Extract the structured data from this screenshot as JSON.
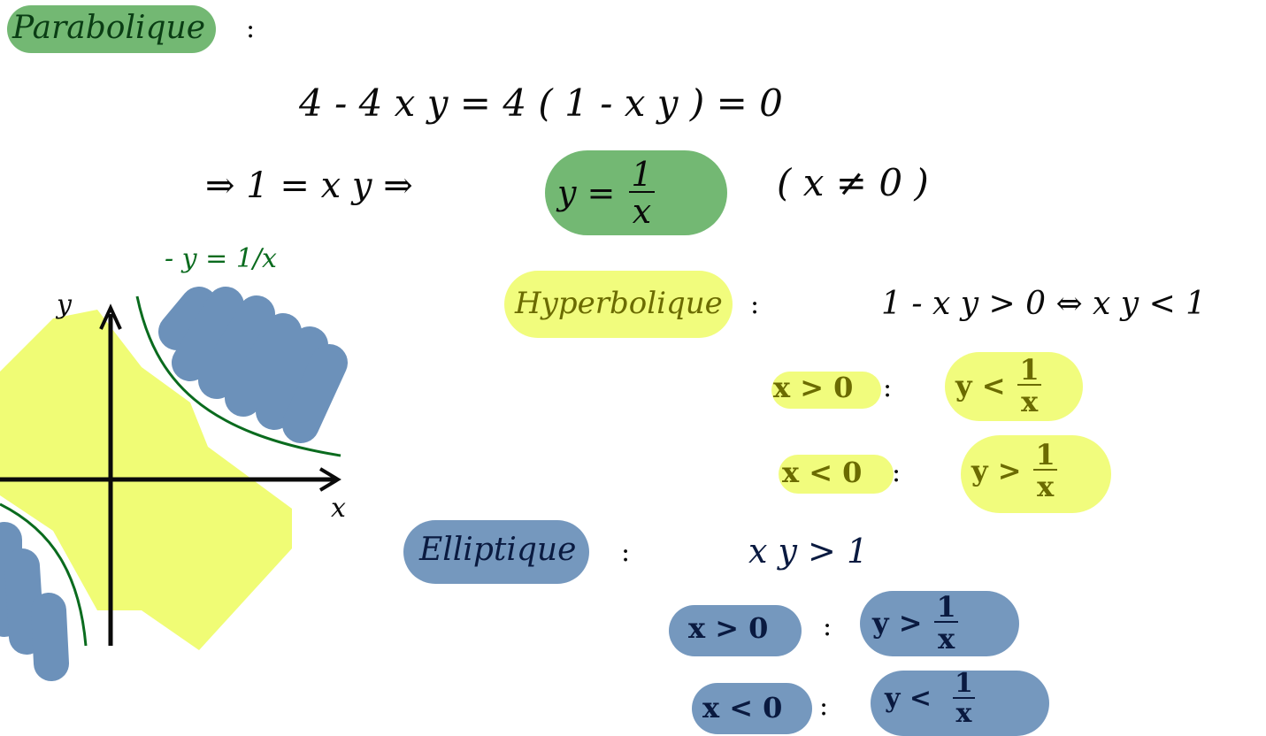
{
  "colors": {
    "green_highlight": "#5aac5a",
    "yellow_highlight": "#eefc66",
    "blue_highlight": "#5d86b3",
    "dark_green_ink": "#0a6b1e",
    "ink": "#0a0a0a"
  },
  "parabolic": {
    "title": "Parabolique",
    "colon": ":",
    "line1": "4 - 4 x y  =  4 ( 1 - x y ) = 0",
    "line2_prefix": "⇒    1 = x y  ⇒",
    "result_left": "y =",
    "result_num": "1",
    "result_den": "x",
    "condition": "( x ≠ 0 )"
  },
  "hyperbolic": {
    "title": "Hyperbolique",
    "colon": ":",
    "statement": "1 - x y > 0  ⇔  x y < 1",
    "case1_cond": "x > 0",
    "case1_colon": ":",
    "case1_res_left": "y <",
    "case1_res_num": "1",
    "case1_res_den": "x",
    "case2_cond": "x < 0",
    "case2_colon": ":",
    "case2_res_left": "y >",
    "case2_res_num": "1",
    "case2_res_den": "x"
  },
  "elliptic": {
    "title": "Elliptique",
    "colon": ":",
    "statement": "x y > 1",
    "case1_cond": "x > 0",
    "case1_colon": ":",
    "case1_res_left": "y >",
    "case1_res_num": "1",
    "case1_res_den": "x",
    "case2_cond": "x < 0",
    "case2_colon": ":",
    "case2_res_left": "y <",
    "case2_res_num": "1",
    "case2_res_den": "x"
  },
  "graph": {
    "curve_label": "- y = 1/x",
    "y_axis_label": "y",
    "x_axis_label": "x"
  }
}
